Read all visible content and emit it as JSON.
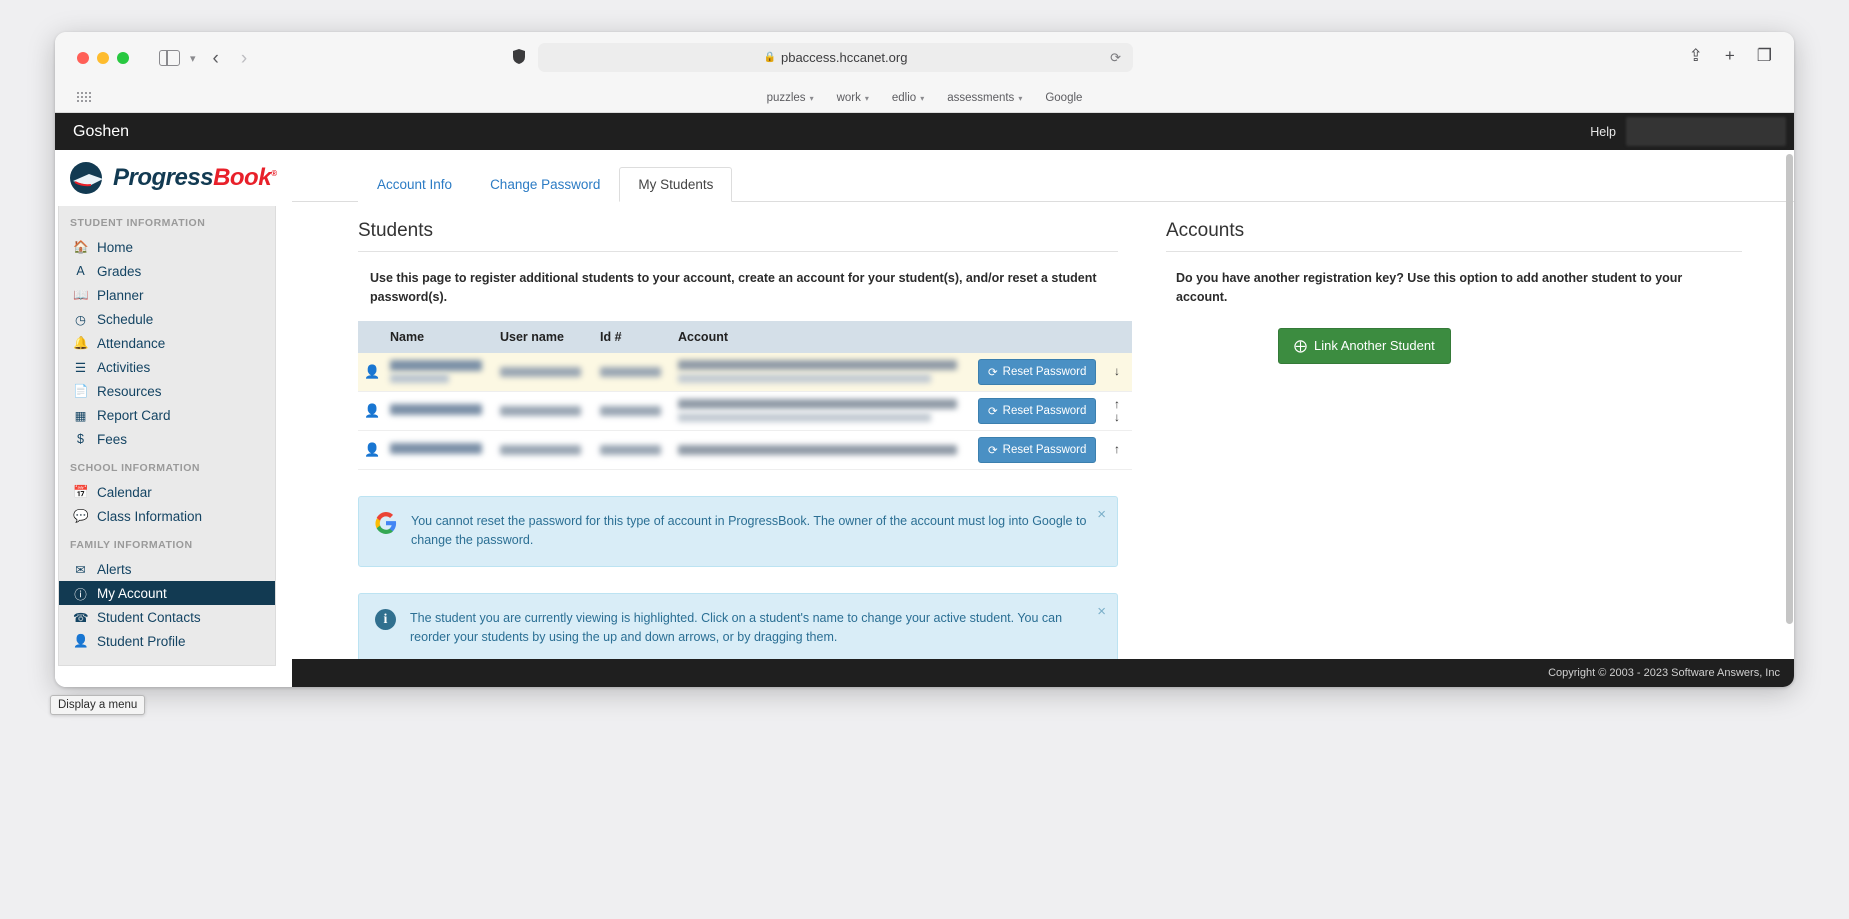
{
  "browser": {
    "url": "pbaccess.hccanet.org",
    "lock_icon": "lock-icon",
    "shield_icon": "shield-icon",
    "reload_icon": "reload-icon",
    "back_icon": "back-arrow-icon",
    "forward_icon": "forward-arrow-icon",
    "sidebar_icon": "sidebar-toggle-icon",
    "share_icon": "share-icon",
    "newtab_icon": "new-tab-icon",
    "tabs_icon": "tab-overview-icon",
    "bookmarks": [
      {
        "label": "puzzles",
        "has_chevron": true
      },
      {
        "label": "work",
        "has_chevron": true
      },
      {
        "label": "edlio",
        "has_chevron": true
      },
      {
        "label": "assessments",
        "has_chevron": true
      },
      {
        "label": "Google",
        "has_chevron": false
      }
    ]
  },
  "app_header": {
    "district": "Goshen",
    "help_label": "Help"
  },
  "logo": {
    "text_part1": "Progress",
    "text_part2": "Book",
    "registered": "®"
  },
  "sidebar": {
    "groups": [
      {
        "title": "STUDENT INFORMATION",
        "items": [
          {
            "label": "Home",
            "icon": "home-icon",
            "glyph": "⌂",
            "active": false
          },
          {
            "label": "Grades",
            "icon": "grades-icon",
            "glyph": "A",
            "active": false
          },
          {
            "label": "Planner",
            "icon": "planner-icon",
            "glyph": "▤",
            "active": false
          },
          {
            "label": "Schedule",
            "icon": "clock-icon",
            "glyph": "◴",
            "active": false
          },
          {
            "label": "Attendance",
            "icon": "bell-icon",
            "glyph": "▲",
            "active": false
          },
          {
            "label": "Activities",
            "icon": "list-icon",
            "glyph": "≡",
            "active": false
          },
          {
            "label": "Resources",
            "icon": "document-icon",
            "glyph": "▮",
            "active": false
          },
          {
            "label": "Report Card",
            "icon": "report-card-icon",
            "glyph": "▦",
            "active": false
          },
          {
            "label": "Fees",
            "icon": "dollar-icon",
            "glyph": "$",
            "active": false
          }
        ]
      },
      {
        "title": "SCHOOL INFORMATION",
        "items": [
          {
            "label": "Calendar",
            "icon": "calendar-icon",
            "glyph": "▦",
            "active": false
          },
          {
            "label": "Class Information",
            "icon": "comment-icon",
            "glyph": "●",
            "active": false
          }
        ]
      },
      {
        "title": "FAMILY INFORMATION",
        "items": [
          {
            "label": "Alerts",
            "icon": "envelope-icon",
            "glyph": "✉",
            "active": false
          },
          {
            "label": "My Account",
            "icon": "info-circle-icon",
            "glyph": "ⓘ",
            "active": true
          },
          {
            "label": "Student Contacts",
            "icon": "phone-icon",
            "glyph": "☎",
            "active": false
          },
          {
            "label": "Student Profile",
            "icon": "person-icon",
            "glyph": "♟",
            "active": false
          }
        ]
      }
    ]
  },
  "tabs": [
    {
      "label": "Account Info",
      "active": false
    },
    {
      "label": "Change Password",
      "active": false
    },
    {
      "label": "My Students",
      "active": true
    }
  ],
  "students_panel": {
    "title": "Students",
    "description": "Use this page to register additional students to your account, create an account for your student(s), and/or reset a student password(s).",
    "table": {
      "columns": [
        "Name",
        "User name",
        "Id #",
        "Account"
      ],
      "rows": [
        {
          "person_icon": "person-icon",
          "name": "[redacted]",
          "user_name": "[redacted]",
          "id_number": "[redacted]",
          "account": "[redacted]",
          "reset_label": "Reset Password",
          "reset_icon": "refresh-icon",
          "arrows": [
            "down"
          ],
          "highlighted": true
        },
        {
          "person_icon": "person-icon",
          "name": "[redacted]",
          "user_name": "[redacted]",
          "id_number": "[redacted]",
          "account": "[redacted]",
          "reset_label": "Reset Password",
          "reset_icon": "refresh-icon",
          "arrows": [
            "up",
            "down"
          ],
          "highlighted": false
        },
        {
          "person_icon": "person-icon",
          "name": "[redacted]",
          "user_name": "[redacted]",
          "id_number": "[redacted]",
          "account": "[redacted]",
          "reset_label": "Reset Password",
          "reset_icon": "refresh-icon",
          "arrows": [
            "up"
          ],
          "highlighted": false
        }
      ]
    },
    "alerts": [
      {
        "icon": "google-logo-icon",
        "icon_letter": "G",
        "text": "You cannot reset the password for this type of account in ProgressBook. The owner of the account must log into Google to change the password.",
        "close_label": "×"
      },
      {
        "icon": "info-icon",
        "icon_letter": "i",
        "text": "The student you are currently viewing is highlighted. Click on a student's name to change your active student. You can reorder your students by using the up and down arrows, or by dragging them.",
        "close_label": "×"
      }
    ]
  },
  "accounts_panel": {
    "title": "Accounts",
    "description": "Do you have another registration key? Use this option to add another student to your account.",
    "link_button_label": "Link Another Student",
    "link_button_icon": "plus-circle-icon"
  },
  "footer": {
    "copyright": "Copyright © 2003 - 2023 Software Answers, Inc"
  },
  "status_tooltip": {
    "text": "Display a menu"
  },
  "colors": {
    "header_bar": "#1f1f1f",
    "sidebar_active": "#123a52",
    "tab_link": "#2b7bc4",
    "reset_button": "#4a90c4",
    "link_button": "#3c8c40",
    "alert_bg": "#d9edf7",
    "row_highlight": "#fcf8e3",
    "table_header": "#d4dfe8",
    "logo_red": "#e8202a"
  }
}
